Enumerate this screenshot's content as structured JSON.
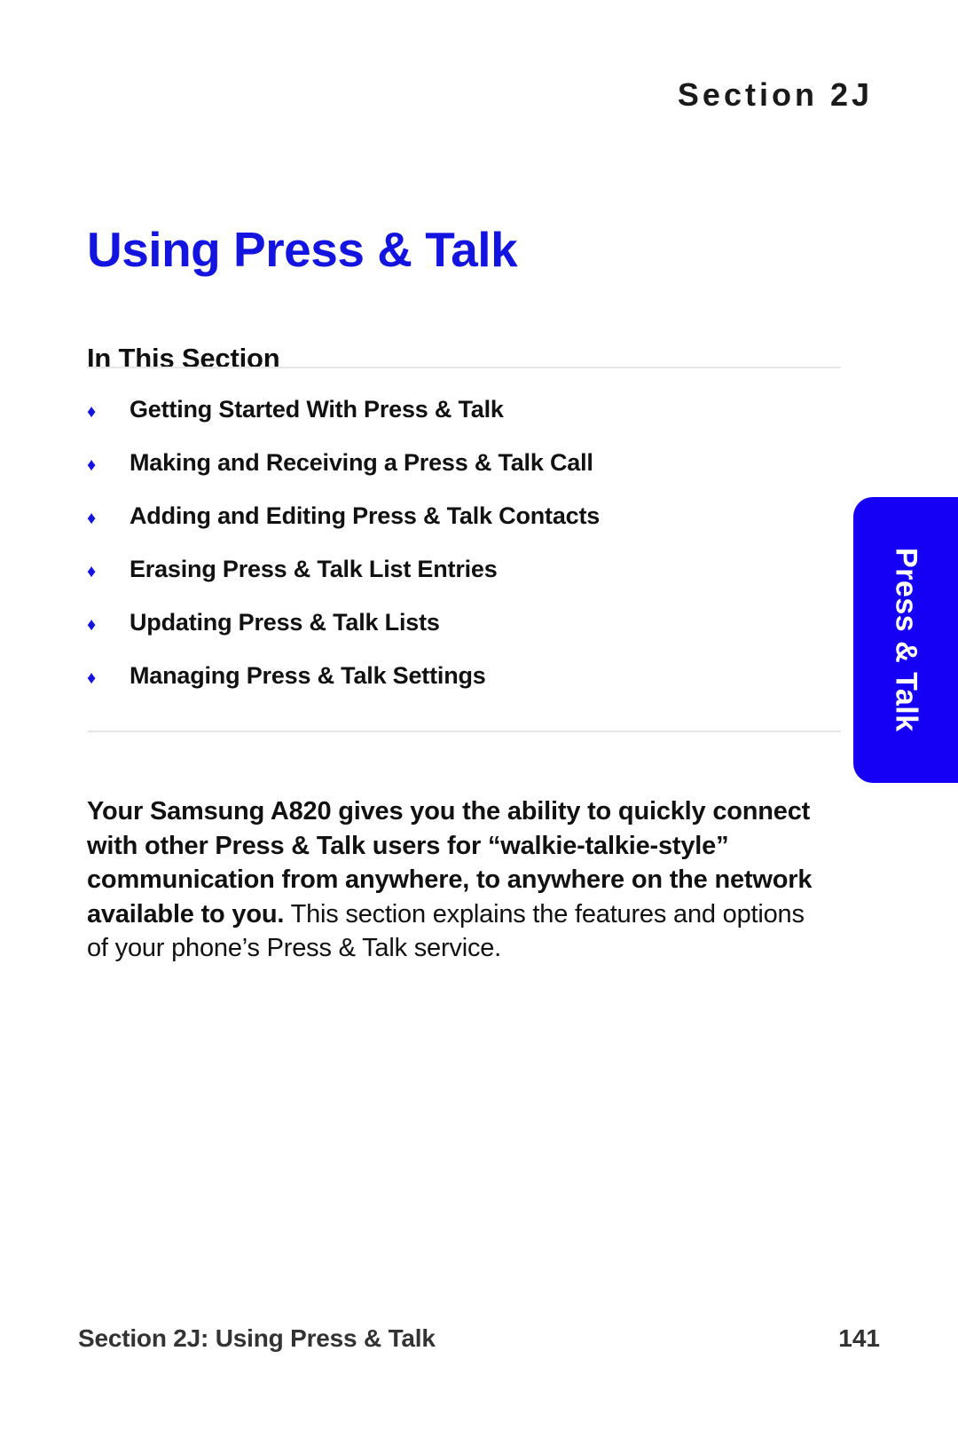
{
  "header": {
    "section_label": "Section 2J"
  },
  "title": {
    "text": "Using Press & Talk",
    "color": "#1414e0"
  },
  "in_this_section": {
    "heading": "In This Section",
    "bullet_glyph": "♦",
    "bullet_color": "#1414e0",
    "items": [
      {
        "label": "Getting Started With Press & Talk"
      },
      {
        "label": "Making and Receiving a Press & Talk Call"
      },
      {
        "label": "Adding and Editing Press & Talk Contacts"
      },
      {
        "label": "Erasing Press & Talk List Entries"
      },
      {
        "label": "Updating Press & Talk Lists"
      },
      {
        "label": "Managing Press & Talk Settings"
      }
    ]
  },
  "intro": {
    "lead": "Your Samsung A820 gives you the ability to quickly connect with other Press & Talk users for “walkie-talkie-style” communication from anywhere, to anywhere on the network available to you.",
    "rest": " This section explains the features and options of your phone’s Press & Talk service."
  },
  "side_tab": {
    "label": "Press & Talk",
    "background": "#1500f5",
    "text_color": "#ffffff"
  },
  "footer": {
    "text": "Section 2J: Using Press & Talk",
    "page_number": "141"
  }
}
